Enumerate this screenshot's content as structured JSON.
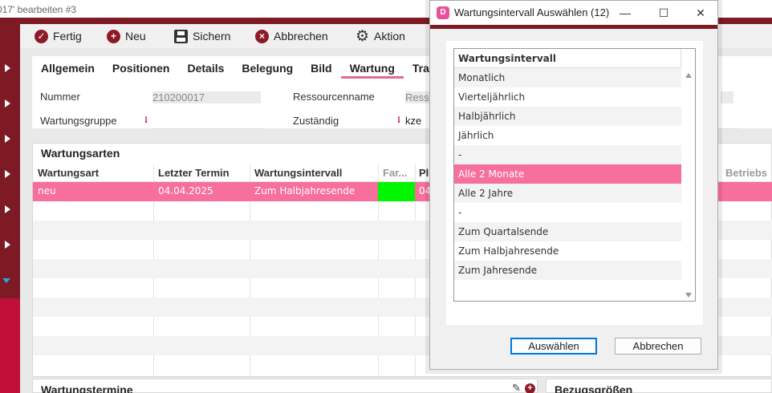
{
  "window": {
    "title": "017' bearbeiten #3"
  },
  "toolbar": {
    "done_label": "Fertig",
    "new_label": "Neu",
    "save_label": "Sichern",
    "cancel_label": "Abbrechen",
    "action_label": "Aktion"
  },
  "tabs": [
    "Allgemein",
    "Positionen",
    "Details",
    "Belegung",
    "Bild",
    "Wartung",
    "Trac"
  ],
  "form": {
    "nummer_label": "Nummer",
    "nummer_value": "210200017",
    "ressourcenname_label": "Ressourcenname",
    "ressourcenname_value": "Resso",
    "wartungsgruppe_label": "Wartungsgruppe",
    "zustaendig_label": "Zuständig",
    "zustaendig_value": "kze",
    "required_marker": "⁝"
  },
  "wartungsarten": {
    "title": "Wartungsarten",
    "columns": [
      "Wartungsart",
      "Letzter Termin",
      "Wartungsintervall",
      "Far...",
      "Pl",
      "Betriebs"
    ],
    "rows": [
      {
        "wartungsart": "neu",
        "letzter_termin": "04.04.2025",
        "wartungsintervall": "Zum Halbjahresende",
        "pl": "04"
      }
    ]
  },
  "bottom": {
    "wartungstermine_title": "Wartungstermine",
    "bezugsgroessen_title": "Bezugsgrößen"
  },
  "dialog": {
    "icon_letter": "D",
    "title": "Wartungsintervall Auswählen (12)",
    "minimize": "—",
    "maximize": "☐",
    "close": "✕",
    "list_header": "Wartungsintervall",
    "items": [
      "Monatlich",
      "Vierteljährlich",
      "Halbjährlich",
      "Jährlich",
      "-",
      "Alle 2 Monate",
      "Alle 2 Jahre",
      "-",
      "Zum Quartalsende",
      "Zum Halbjahresende",
      "Zum Jahresende"
    ],
    "selected_index": 5,
    "select_label": "Auswählen",
    "cancel_label": "Abbrechen"
  },
  "colors": {
    "brand": "#7d1a24",
    "accent_pink": "#f76f9b",
    "sidebar_lower": "#c0103a",
    "green": "#00f500"
  }
}
